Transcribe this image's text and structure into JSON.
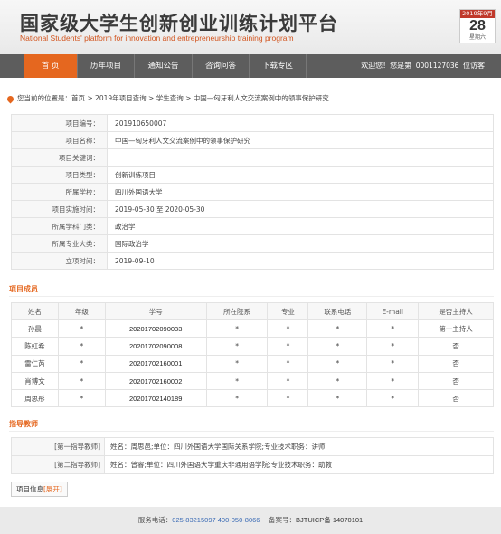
{
  "header": {
    "title_cn": "国家级大学生创新创业训练计划平台",
    "title_en": "National Students' platform for innovation and entrepreneurship training program",
    "calendar": {
      "month": "2019年9月",
      "day": "28",
      "weekday": "星期六"
    }
  },
  "nav": {
    "items": [
      "首 页",
      "历年项目",
      "通知公告",
      "咨询问答",
      "下载专区"
    ],
    "welcome_prefix": "欢迎您！您是第",
    "visitor_number": "0001127036",
    "welcome_suffix": "位访客"
  },
  "breadcrumb": {
    "label": "您当前的位置是：",
    "path": "首页 > 2019年项目查询 > 学生查询 > 中国—匈牙利人文交流案例中的领事保护研究"
  },
  "project_info": [
    {
      "label": "项目编号：",
      "value": "201910650007"
    },
    {
      "label": "项目名称：",
      "value": "中国—匈牙利人文交流案例中的领事保护研究"
    },
    {
      "label": "项目关键词：",
      "value": ""
    },
    {
      "label": "项目类型：",
      "value": "创新训练项目"
    },
    {
      "label": "所属学校：",
      "value": "四川外国语大学"
    },
    {
      "label": "项目实施时间：",
      "value": "2019-05-30 至 2020-05-30"
    },
    {
      "label": "所属学科门类：",
      "value": "政治学"
    },
    {
      "label": "所属专业大类：",
      "value": "国际政治学"
    },
    {
      "label": "立项时间：",
      "value": "2019-09-10"
    }
  ],
  "members_section": {
    "title": "项目成员",
    "headers": [
      "姓名",
      "年级",
      "学号",
      "所在院系",
      "专业",
      "联系电话",
      "E-mail",
      "是否主持人"
    ],
    "rows": [
      [
        "孙晨",
        "*",
        "20201702090033",
        "*",
        "*",
        "*",
        "*",
        "第一主持人"
      ],
      [
        "陈虹希",
        "*",
        "20201702090008",
        "*",
        "*",
        "*",
        "*",
        "否"
      ],
      [
        "雷仁芮",
        "*",
        "20201702160001",
        "*",
        "*",
        "*",
        "*",
        "否"
      ],
      [
        "肖博文",
        "*",
        "20201702160002",
        "*",
        "*",
        "*",
        "*",
        "否"
      ],
      [
        "周思彤",
        "*",
        "20201702140189",
        "*",
        "*",
        "*",
        "*",
        "否"
      ]
    ]
  },
  "advisors_section": {
    "title": "指导教师",
    "rows": [
      {
        "label": "[第一指导教师]",
        "value": "姓名：周思邑;单位：四川外国语大学国际关系学院;专业技术职务：讲师"
      },
      {
        "label": "[第二指导教师]",
        "value": "姓名：曾睿;单位：四川外国语大学重庆非通用语学院;专业技术职务：助教"
      }
    ]
  },
  "project_button": {
    "label": "项目信息",
    "expand": "[展开]"
  },
  "footer": {
    "phone_label": "服务电话：",
    "phone": "025-83215097 400-050-8066",
    "icp_label": "备案号：",
    "icp": "BJTUICP备 14070101"
  },
  "colors": {
    "accent": "#e5671f",
    "nav_bg": "#5d5d5d",
    "link_blue": "#3b6bb5"
  }
}
